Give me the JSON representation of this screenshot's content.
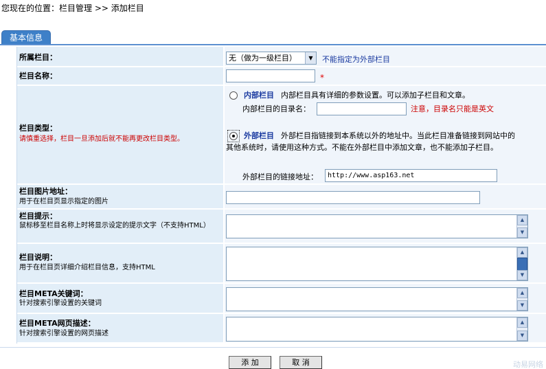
{
  "breadcrumb": "您现在的位置：栏目管理 >> 添加栏目",
  "tab_label": "基本信息",
  "parent": {
    "label": "所属栏目：",
    "select_value": "无（做为一级栏目）",
    "hint": "不能指定为外部栏目"
  },
  "name": {
    "label": "栏目名称：",
    "value": "",
    "required": "*"
  },
  "type": {
    "label": "栏目类型：",
    "warning": "请慎重选择，栏目一旦添加后就不能再更改栏目类型。",
    "internal": {
      "title": "内部栏目",
      "desc": "内部栏目具有详细的参数设置。可以添加子栏目和文章。",
      "dir_label": "内部栏目的目录名：",
      "dir_value": "",
      "dir_note": "注意，目录名只能是英文",
      "checked": false
    },
    "external": {
      "title": "外部栏目",
      "desc": "外部栏目指链接到本系统以外的地址中。当此栏目准备链接到网站中的其他系统时，请使用这种方式。不能在外部栏目中添加文章，也不能添加子栏目。",
      "url_label": "外部栏目的链接地址：",
      "url_value": "http://www.asp163.net",
      "checked": true
    }
  },
  "image": {
    "label": "栏目图片地址：",
    "note": "用于在栏目页显示指定的图片",
    "value": ""
  },
  "tips": {
    "label": "栏目提示：",
    "note": "鼠标移至栏目名称上时将显示设定的提示文字（不支持HTML）",
    "value": ""
  },
  "desc": {
    "label": "栏目说明：",
    "note": "用于在栏目页详细介绍栏目信息，支持HTML",
    "value": ""
  },
  "meta_keywords": {
    "label": "栏目META关键词：",
    "note": "针对搜索引擎设置的关键词",
    "value": ""
  },
  "meta_desc": {
    "label": "栏目META网页描述：",
    "note": "针对搜索引擎设置的网页描述",
    "value": ""
  },
  "buttons": {
    "add": "添 加",
    "cancel": "取 消"
  },
  "watermark": "动易网络"
}
